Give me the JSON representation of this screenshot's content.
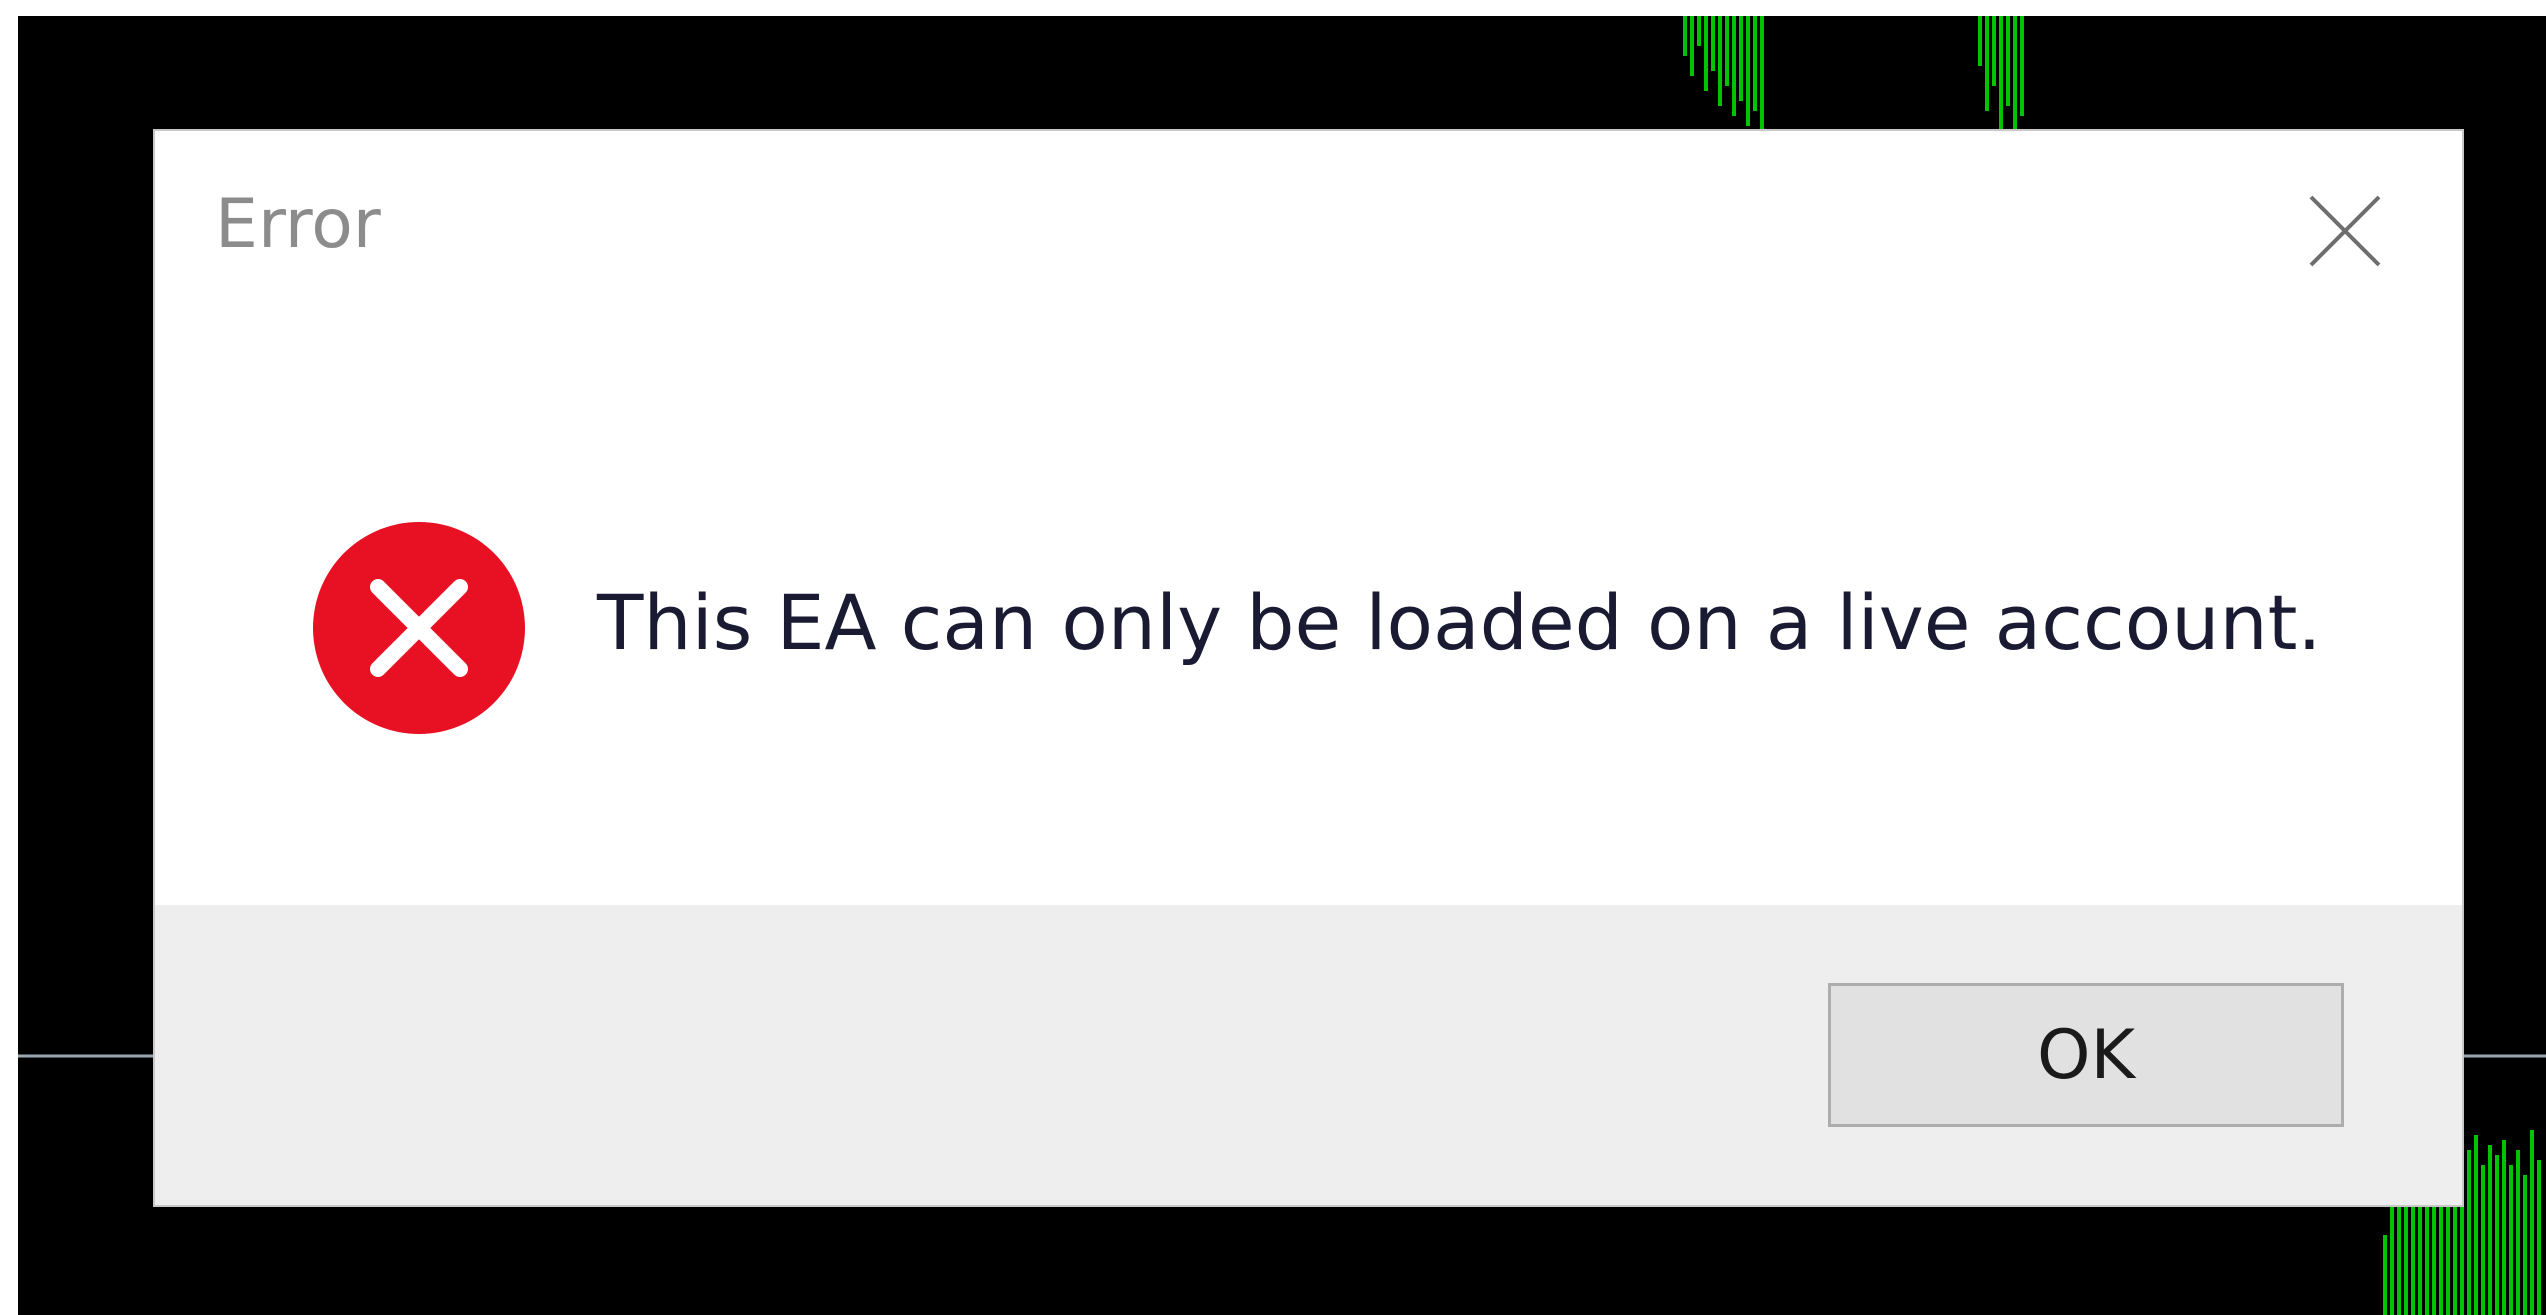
{
  "background": {
    "chart_bg_color": "#000000",
    "candle_color": "#00c400",
    "gridline_color": "#9aa8b3"
  },
  "dialog": {
    "title": "Error",
    "message": "This EA can only be loaded on a live account.",
    "ok_label": "OK",
    "icon": "error-x-circle-icon",
    "icon_color": "#e81123",
    "close_icon": "close-x-icon",
    "footer_color": "#eeeeee"
  }
}
